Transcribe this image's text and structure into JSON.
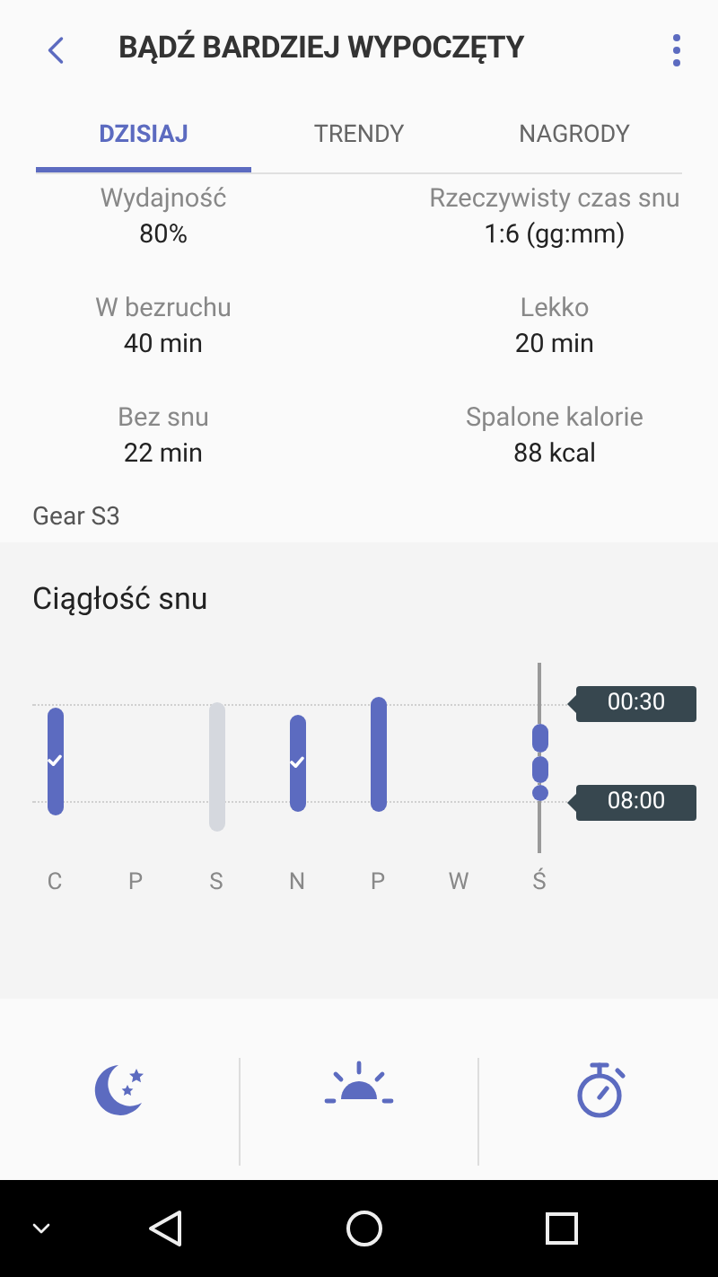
{
  "header": {
    "title": "BĄDŹ BARDZIEJ WYPOCZĘTY"
  },
  "tabs": [
    {
      "label": "DZISIAJ",
      "selected": true
    },
    {
      "label": "TRENDY",
      "selected": false
    },
    {
      "label": "NAGRODY",
      "selected": false
    }
  ],
  "stats": [
    {
      "label": "Wydajność",
      "value": "80%"
    },
    {
      "label": "Rzeczywisty czas snu",
      "value": "1:6 (gg:mm)"
    },
    {
      "label": "W bezruchu",
      "value": "40 min"
    },
    {
      "label": "Lekko",
      "value": "20 min"
    },
    {
      "label": "Bez snu",
      "value": "22 min"
    },
    {
      "label": "Spalone kalorie",
      "value": "88 kcal"
    }
  ],
  "device": "Gear S3",
  "continuity": {
    "title": "Ciągłość snu",
    "days": [
      {
        "label": "C",
        "kind": "bar",
        "checked": true
      },
      {
        "label": "P",
        "kind": "none"
      },
      {
        "label": "S",
        "kind": "missing"
      },
      {
        "label": "N",
        "kind": "bar",
        "checked": true
      },
      {
        "label": "P",
        "kind": "bar",
        "checked": false
      },
      {
        "label": "W",
        "kind": "none"
      },
      {
        "label": "Ś",
        "kind": "segments"
      }
    ],
    "times": [
      "00:30",
      "08:00"
    ]
  },
  "summary": [
    {
      "kind": "bedtime"
    },
    {
      "kind": "wake"
    },
    {
      "kind": "duration"
    }
  ]
}
